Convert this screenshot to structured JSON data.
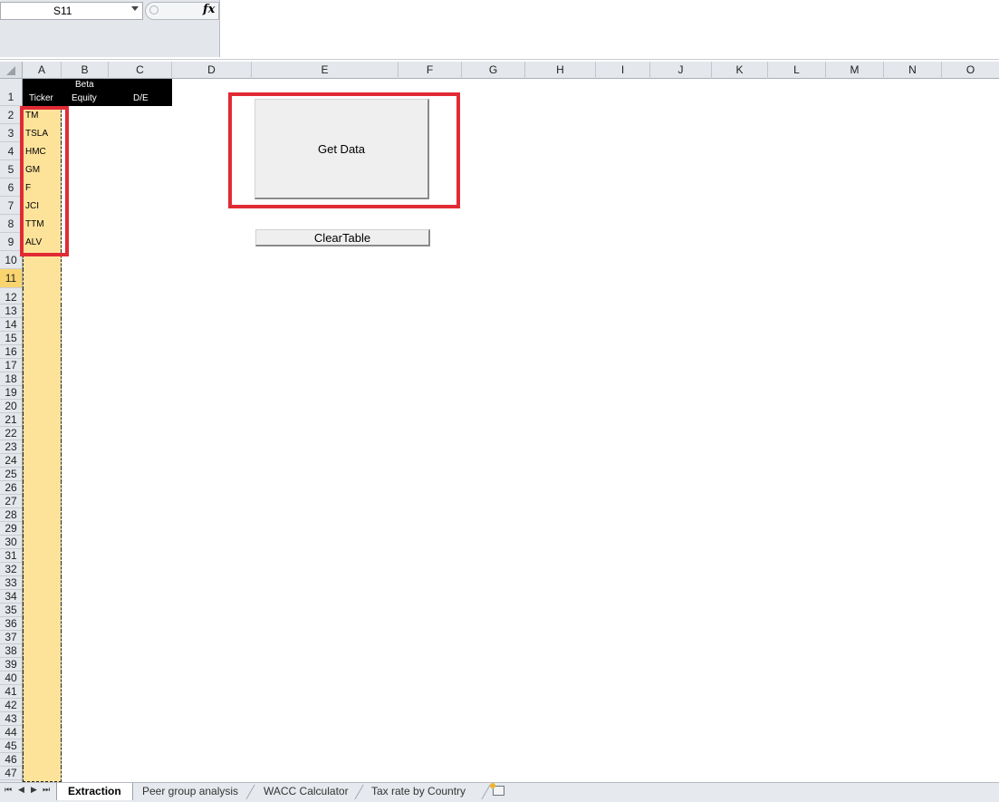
{
  "formula_bar": {
    "name_box": "S11",
    "fx_label": "fx",
    "formula_value": ""
  },
  "columns": [
    "A",
    "B",
    "C",
    "D",
    "E",
    "F",
    "G",
    "H",
    "I",
    "J",
    "K",
    "L",
    "M",
    "N",
    "O"
  ],
  "rows": [
    "1",
    "2",
    "3",
    "4",
    "5",
    "6",
    "7",
    "8",
    "9",
    "10",
    "11",
    "12",
    "13",
    "14",
    "15",
    "16",
    "17",
    "18",
    "19",
    "20",
    "21",
    "22",
    "23",
    "24",
    "25",
    "26",
    "27",
    "28",
    "29",
    "30",
    "31",
    "32",
    "33",
    "34",
    "35",
    "36",
    "37",
    "38",
    "39",
    "40",
    "41",
    "42",
    "43",
    "44",
    "45",
    "46",
    "47"
  ],
  "active_row": "11",
  "header_row": {
    "ticker": "Ticker",
    "beta_line1": "Beta",
    "beta_line2": "Equity",
    "de": "D/E"
  },
  "tickers": [
    "TM",
    "TSLA",
    "HMC",
    "GM",
    "F",
    "JCI",
    "TTM",
    "ALV"
  ],
  "buttons": {
    "get_data": "Get Data",
    "clear_table": "ClearTable"
  },
  "sheet_tabs": [
    "Extraction",
    "Peer group analysis",
    "WACC Calculator",
    "Tax rate by Country"
  ],
  "active_tab": "Extraction",
  "colors": {
    "highlight_red": "#e02b35",
    "input_yellow": "#fde39a",
    "active_row_header": "#f9d46f",
    "header_black": "#000000"
  }
}
